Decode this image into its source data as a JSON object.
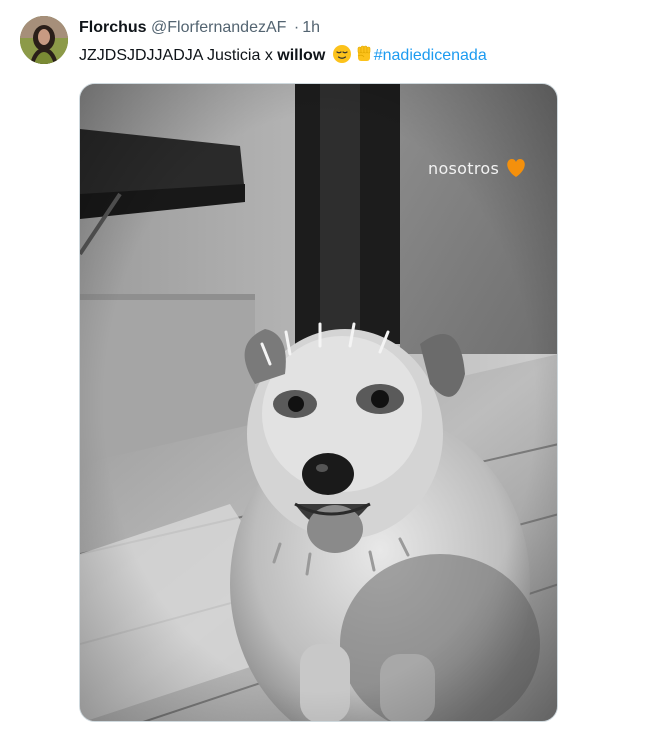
{
  "tweet": {
    "display_name": "Florchus",
    "handle": "@FlorfernandezAF",
    "separator": "·",
    "time": "1h",
    "text_prefix": "JZJDSJDJJADJA Justicia x ",
    "text_bold": "willow",
    "emojis": [
      "relieved-face",
      "raised-fist"
    ],
    "hashtag": "#nadiedicenada",
    "colors": {
      "name": "#0f1419",
      "meta": "#536471",
      "hashtag": "#1d9bf0",
      "border": "#cfd9de"
    }
  },
  "media": {
    "overlay_text": "nosotros",
    "overlay_emoji": "orange-heart",
    "style": "black-and-white photo of a scruffy dog"
  }
}
